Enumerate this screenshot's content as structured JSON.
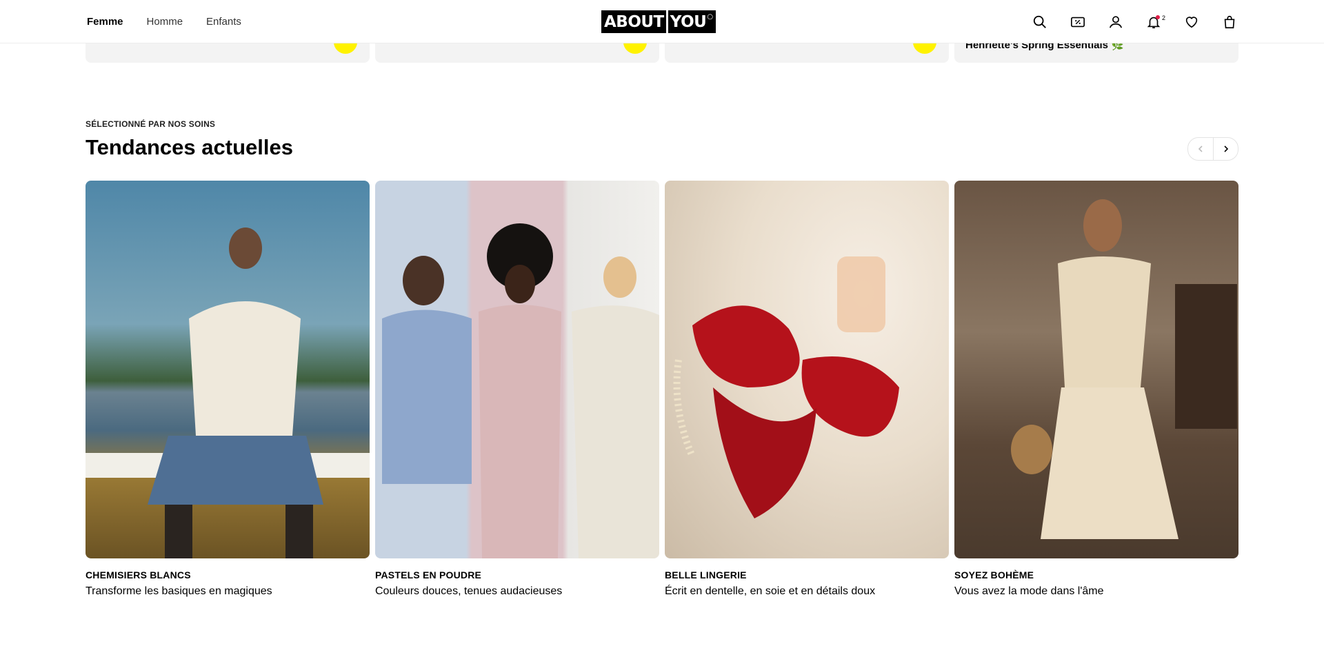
{
  "header": {
    "nav": [
      "Femme",
      "Homme",
      "Enfants"
    ],
    "logo": {
      "left": "ABOUT",
      "right": "YOU"
    },
    "icons": [
      "search-icon",
      "discount-icon",
      "account-icon",
      "bell-icon",
      "heart-icon",
      "bag-icon"
    ],
    "notifications_count": "2"
  },
  "top_cards": [
    {
      "title": ""
    },
    {
      "title": ""
    },
    {
      "title": ""
    },
    {
      "title": "Henriette's Spring Essentials 🌿"
    }
  ],
  "section": {
    "eyebrow": "SÉLECTIONNÉ PAR NOS SOINS",
    "title": "Tendances actuelles",
    "cards": [
      {
        "label": "CHEMISIERS BLANCS",
        "desc": "Transforme les basiques en magiques"
      },
      {
        "label": "PASTELS EN POUDRE",
        "desc": "Couleurs douces, tenues audacieuses"
      },
      {
        "label": "BELLE LINGERIE",
        "desc": "Écrit en dentelle, en soie et en détails doux"
      },
      {
        "label": "SOYEZ BOHÈME",
        "desc": "Vous avez la mode dans l'âme"
      }
    ]
  },
  "colors": {
    "accent_yellow": "#fff200",
    "notification_dot": "#e11d48"
  }
}
